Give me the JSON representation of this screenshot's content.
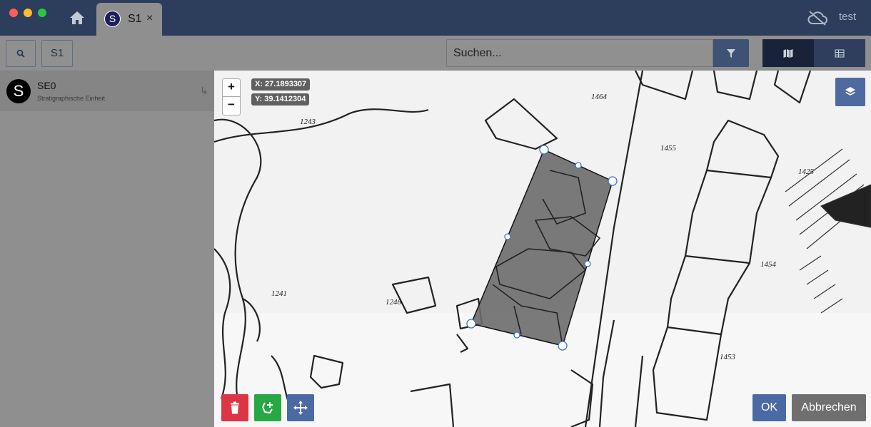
{
  "window": {
    "tab_avatar_letter": "S",
    "tab_label": "S1",
    "tab_close": "×",
    "user": "test",
    "icons": [
      "home-icon",
      "cloud-off-icon",
      "close-icon"
    ]
  },
  "toolbar": {
    "search_icon": "search-icon",
    "active_button_label": "S1",
    "search_placeholder": "Suchen...",
    "filter_icon": "filter-icon",
    "view_map_icon": "map-icon",
    "view_table_icon": "table-icon"
  },
  "sidebar": {
    "items": [
      {
        "avatar_letter": "S",
        "title": "SE0",
        "subtitle": "Stratigraphische Einheit",
        "jump_glyph": "↳"
      }
    ]
  },
  "map": {
    "zoom_in": "+",
    "zoom_out": "−",
    "coord_x": "X: 27.1893307",
    "coord_y": "Y: 39.1412304",
    "plan_labels": [
      "1243",
      "1241",
      "1246",
      "1464",
      "1455",
      "1425",
      "1454",
      "1453"
    ],
    "layers_icon": "layers-icon",
    "delete_icon": "trash-icon",
    "add_polygon_icon": "add-polygon-icon",
    "move_icon": "move-icon",
    "ok_label": "OK",
    "cancel_label": "Abbrechen"
  },
  "colors": {
    "titlebar": "#2d3e5c",
    "primary": "#4a6aa5",
    "danger": "#dc3545",
    "success": "#28a745",
    "secondary": "#6f6f6f"
  }
}
